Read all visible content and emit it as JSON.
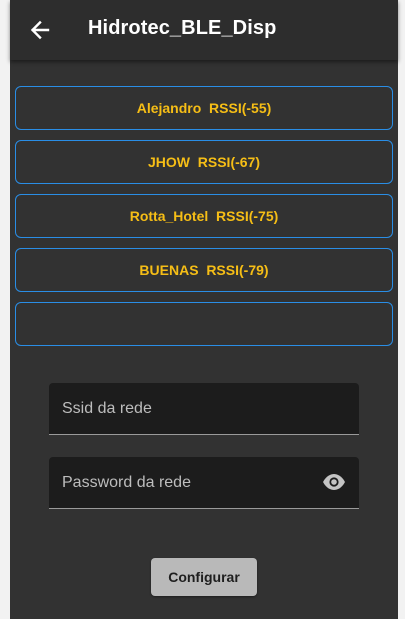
{
  "appbar": {
    "title": "Hidrotec_BLE_Disp",
    "back_icon": "arrow-left-icon"
  },
  "devices": [
    {
      "label": "Alejandro  RSSI(-55)"
    },
    {
      "label": "JHOW  RSSI(-67)"
    },
    {
      "label": "Rotta_Hotel  RSSI(-75)"
    },
    {
      "label": "BUENAS  RSSI(-79)"
    },
    {
      "label": ""
    }
  ],
  "form": {
    "ssid_placeholder": "Ssid da rede",
    "password_placeholder": "Password da rede",
    "visibility_icon": "eye-icon",
    "submit_label": "Configurar"
  },
  "colors": {
    "background": "#323232",
    "appbar": "#2d2d2d",
    "accent_text": "#f6be16",
    "border": "#2a8ee6",
    "button": "#b9b9b9"
  }
}
